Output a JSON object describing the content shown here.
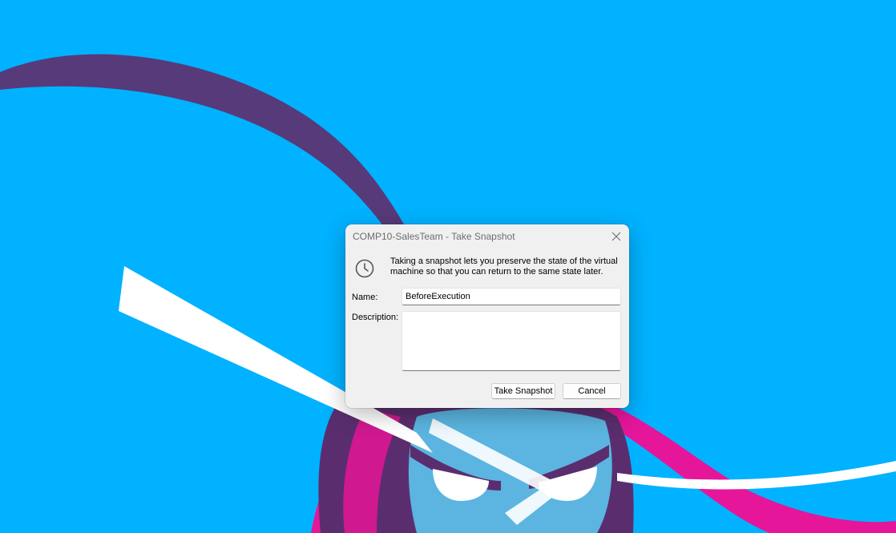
{
  "dialog": {
    "title": "COMP10-SalesTeam - Take Snapshot",
    "info_text": "Taking a snapshot lets you preserve the state of the virtual machine so that you can return to the same state later.",
    "name_label": "Name:",
    "name_value": "BeforeExecution",
    "description_label": "Description:",
    "description_value": "",
    "take_snapshot_label": "Take Snapshot",
    "cancel_label": "Cancel"
  },
  "icons": {
    "close": "close-icon",
    "snapshot": "clock-icon"
  },
  "colors": {
    "desktop_background": "#00b2ff",
    "wallpaper_purple": "#573a7a",
    "wallpaper_magenta": "#e5169a",
    "dialog_background": "#f0f0f0"
  }
}
